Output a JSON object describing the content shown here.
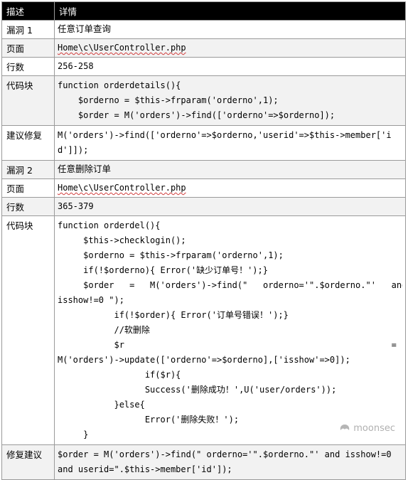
{
  "header": {
    "col1": "描述",
    "col2": "详情"
  },
  "v1": {
    "vuln_label": "漏洞 1",
    "vuln_title": "任意订单查询",
    "page_label": "页面",
    "page_value": "Home\\c\\UserController.php",
    "lines_label": "行数",
    "lines_value": "256-258",
    "code_label": "代码块",
    "code": [
      "function orderdetails(){",
      "    $orderno = $this->frparam('orderno',1);",
      "    $order = M('orders')->find(['orderno'=>$orderno]);"
    ],
    "fix_label": "建议修复",
    "fix_lines": [
      "M('orders')->find(['orderno'=>$orderno,'userid'=>$this->member['i",
      "d']]);"
    ]
  },
  "v2": {
    "vuln_label": "漏洞 2",
    "vuln_title": "任意删除订单",
    "page_label": "页面",
    "page_value": "Home\\c\\UserController.php",
    "lines_label": "行数",
    "lines_value": "365-379",
    "code_label": "代码块",
    "code": [
      "function orderdel(){",
      "     $this->checklogin();",
      "     $orderno = $this->frparam('orderno',1);",
      "     if(!$orderno){ Error('缺少订单号！');}",
      "     $order   =   M('orders')->find(\"   orderno='\".$orderno.\"'   and",
      "isshow!=0 \");",
      "           if(!$order){ Error('订单号错误！');}",
      "           //软删除",
      "           $r                                                    =",
      "M('orders')->update(['orderno'=>$orderno],['isshow'=>0]);",
      "                 if($r){",
      "                 Success('删除成功！',U('user/orders'));",
      "           }else{",
      "                 Error('删除失败！');",
      "     }"
    ],
    "fix_label": "修复建议",
    "fix_lines": [
      "$order = M('orders')->find(\" orderno='\".$orderno.\"' and isshow!=0",
      "and userid=\".$this->member['id']);"
    ]
  },
  "watermark": "moonsec"
}
